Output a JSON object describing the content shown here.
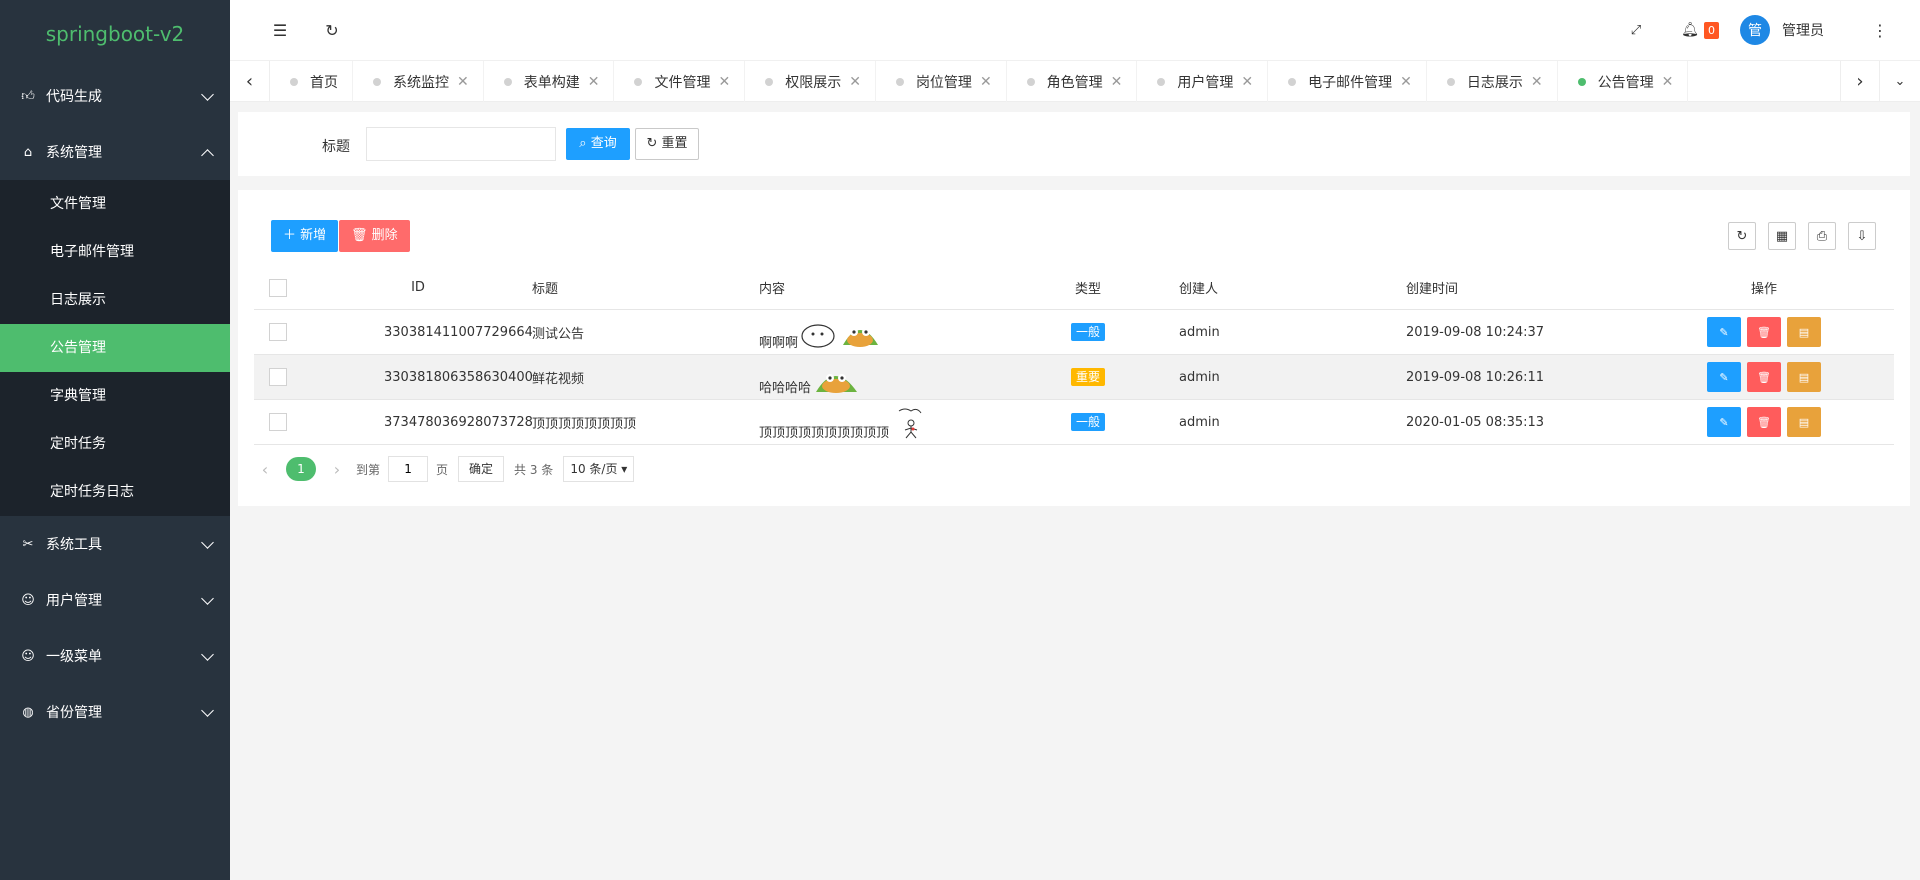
{
  "sidebar": {
    "logo": "springboot-v2",
    "groups": [
      {
        "label": "代码生成",
        "icon": "thumb-up-icon",
        "expanded": false
      },
      {
        "label": "系统管理",
        "icon": "home-icon",
        "expanded": true
      },
      {
        "label": "系统工具",
        "icon": "tools-icon",
        "expanded": false
      },
      {
        "label": "用户管理",
        "icon": "user-icon",
        "expanded": false
      },
      {
        "label": "一级菜单",
        "icon": "smile-icon",
        "expanded": false
      },
      {
        "label": "省份管理",
        "icon": "globe-icon",
        "expanded": false
      }
    ],
    "sub_items": [
      "文件管理",
      "电子邮件管理",
      "日志展示",
      "公告管理",
      "字典管理",
      "定时任务",
      "定时任务日志"
    ],
    "active_sub": "公告管理"
  },
  "header": {
    "notify_count": "0",
    "avatar_char": "管",
    "username": "管理员"
  },
  "tabs": {
    "items": [
      {
        "label": "首页",
        "closable": false,
        "active": false
      },
      {
        "label": "系统监控",
        "closable": true,
        "active": false
      },
      {
        "label": "表单构建",
        "closable": true,
        "active": false
      },
      {
        "label": "文件管理",
        "closable": true,
        "active": false
      },
      {
        "label": "权限展示",
        "closable": true,
        "active": false
      },
      {
        "label": "岗位管理",
        "closable": true,
        "active": false
      },
      {
        "label": "角色管理",
        "closable": true,
        "active": false
      },
      {
        "label": "用户管理",
        "closable": true,
        "active": false
      },
      {
        "label": "电子邮件管理",
        "closable": true,
        "active": false
      },
      {
        "label": "日志展示",
        "closable": true,
        "active": false
      },
      {
        "label": "公告管理",
        "closable": true,
        "active": true
      }
    ]
  },
  "search": {
    "title_label": "标题",
    "title_value": "",
    "query_label": "查询",
    "reset_label": "重置"
  },
  "toolbar": {
    "add_label": "新增",
    "delete_label": "删除"
  },
  "table": {
    "columns": [
      "ID",
      "标题",
      "内容",
      "类型",
      "创建人",
      "创建时间",
      "操作"
    ],
    "rows": [
      {
        "id": "330381411007729664",
        "title": "测试公告",
        "content": "啊啊啊",
        "type": "一般",
        "type_color": "#1e9fff",
        "creator": "admin",
        "created": "2019-09-08 10:24:37"
      },
      {
        "id": "330381806358630400",
        "title": "鲜花视频",
        "content": "哈哈哈哈",
        "type": "重要",
        "type_color": "#ffb800",
        "creator": "admin",
        "created": "2019-09-08 10:26:11"
      },
      {
        "id": "373478036928073728",
        "title": "顶顶顶顶顶顶顶顶",
        "content": "顶顶顶顶顶顶顶顶顶顶",
        "type": "一般",
        "type_color": "#1e9fff",
        "creator": "admin",
        "created": "2020-01-05 08:35:13"
      }
    ]
  },
  "pager": {
    "current": "1",
    "goto_label": "到第",
    "page_value": "1",
    "page_unit": "页",
    "confirm_label": "确定",
    "total_label": "共 3 条",
    "page_size": "10 条/页"
  },
  "colors": {
    "accent": "#4ebd6e",
    "sidebar_bg": "#28333e",
    "blue": "#1e9fff",
    "red": "#ff5c5c",
    "orange": "#e8a23b"
  }
}
